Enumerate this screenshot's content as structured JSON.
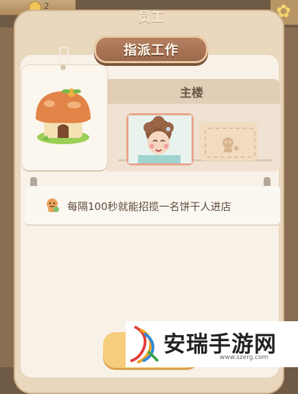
{
  "hud": {
    "count": "2"
  },
  "panel": {
    "title": "员工",
    "plaque": "指派工作"
  },
  "building": {
    "name": "主楼"
  },
  "description": "每隔100秒就能招揽一名饼干人进店",
  "watermark": {
    "name": "安瑞手游网",
    "url": "www.szerg.com"
  },
  "colors": {
    "panel": "#e9d7be",
    "plaque": "#9b6749",
    "accent_button": "#f6cd7d",
    "text": "#5e4b3a"
  },
  "icons": {
    "building": "mushroom-house-icon",
    "worker": "grandma-avatar",
    "add_slot": "add-worker-icon",
    "desc": "cookie-face-icon"
  }
}
